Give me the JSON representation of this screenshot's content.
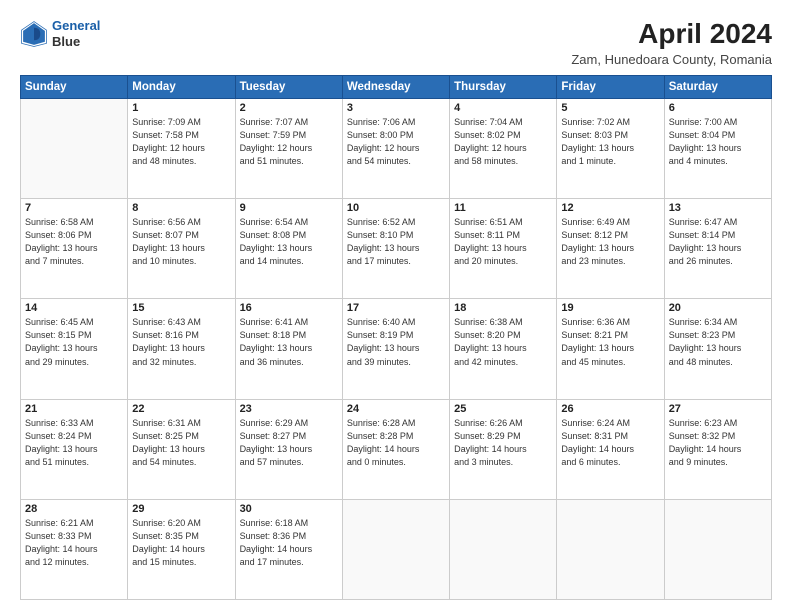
{
  "header": {
    "logo_line1": "General",
    "logo_line2": "Blue",
    "title": "April 2024",
    "subtitle": "Zam, Hunedoara County, Romania"
  },
  "days_of_week": [
    "Sunday",
    "Monday",
    "Tuesday",
    "Wednesday",
    "Thursday",
    "Friday",
    "Saturday"
  ],
  "weeks": [
    [
      {
        "day": "",
        "text": ""
      },
      {
        "day": "1",
        "text": "Sunrise: 7:09 AM\nSunset: 7:58 PM\nDaylight: 12 hours\nand 48 minutes."
      },
      {
        "day": "2",
        "text": "Sunrise: 7:07 AM\nSunset: 7:59 PM\nDaylight: 12 hours\nand 51 minutes."
      },
      {
        "day": "3",
        "text": "Sunrise: 7:06 AM\nSunset: 8:00 PM\nDaylight: 12 hours\nand 54 minutes."
      },
      {
        "day": "4",
        "text": "Sunrise: 7:04 AM\nSunset: 8:02 PM\nDaylight: 12 hours\nand 58 minutes."
      },
      {
        "day": "5",
        "text": "Sunrise: 7:02 AM\nSunset: 8:03 PM\nDaylight: 13 hours\nand 1 minute."
      },
      {
        "day": "6",
        "text": "Sunrise: 7:00 AM\nSunset: 8:04 PM\nDaylight: 13 hours\nand 4 minutes."
      }
    ],
    [
      {
        "day": "7",
        "text": "Sunrise: 6:58 AM\nSunset: 8:06 PM\nDaylight: 13 hours\nand 7 minutes."
      },
      {
        "day": "8",
        "text": "Sunrise: 6:56 AM\nSunset: 8:07 PM\nDaylight: 13 hours\nand 10 minutes."
      },
      {
        "day": "9",
        "text": "Sunrise: 6:54 AM\nSunset: 8:08 PM\nDaylight: 13 hours\nand 14 minutes."
      },
      {
        "day": "10",
        "text": "Sunrise: 6:52 AM\nSunset: 8:10 PM\nDaylight: 13 hours\nand 17 minutes."
      },
      {
        "day": "11",
        "text": "Sunrise: 6:51 AM\nSunset: 8:11 PM\nDaylight: 13 hours\nand 20 minutes."
      },
      {
        "day": "12",
        "text": "Sunrise: 6:49 AM\nSunset: 8:12 PM\nDaylight: 13 hours\nand 23 minutes."
      },
      {
        "day": "13",
        "text": "Sunrise: 6:47 AM\nSunset: 8:14 PM\nDaylight: 13 hours\nand 26 minutes."
      }
    ],
    [
      {
        "day": "14",
        "text": "Sunrise: 6:45 AM\nSunset: 8:15 PM\nDaylight: 13 hours\nand 29 minutes."
      },
      {
        "day": "15",
        "text": "Sunrise: 6:43 AM\nSunset: 8:16 PM\nDaylight: 13 hours\nand 32 minutes."
      },
      {
        "day": "16",
        "text": "Sunrise: 6:41 AM\nSunset: 8:18 PM\nDaylight: 13 hours\nand 36 minutes."
      },
      {
        "day": "17",
        "text": "Sunrise: 6:40 AM\nSunset: 8:19 PM\nDaylight: 13 hours\nand 39 minutes."
      },
      {
        "day": "18",
        "text": "Sunrise: 6:38 AM\nSunset: 8:20 PM\nDaylight: 13 hours\nand 42 minutes."
      },
      {
        "day": "19",
        "text": "Sunrise: 6:36 AM\nSunset: 8:21 PM\nDaylight: 13 hours\nand 45 minutes."
      },
      {
        "day": "20",
        "text": "Sunrise: 6:34 AM\nSunset: 8:23 PM\nDaylight: 13 hours\nand 48 minutes."
      }
    ],
    [
      {
        "day": "21",
        "text": "Sunrise: 6:33 AM\nSunset: 8:24 PM\nDaylight: 13 hours\nand 51 minutes."
      },
      {
        "day": "22",
        "text": "Sunrise: 6:31 AM\nSunset: 8:25 PM\nDaylight: 13 hours\nand 54 minutes."
      },
      {
        "day": "23",
        "text": "Sunrise: 6:29 AM\nSunset: 8:27 PM\nDaylight: 13 hours\nand 57 minutes."
      },
      {
        "day": "24",
        "text": "Sunrise: 6:28 AM\nSunset: 8:28 PM\nDaylight: 14 hours\nand 0 minutes."
      },
      {
        "day": "25",
        "text": "Sunrise: 6:26 AM\nSunset: 8:29 PM\nDaylight: 14 hours\nand 3 minutes."
      },
      {
        "day": "26",
        "text": "Sunrise: 6:24 AM\nSunset: 8:31 PM\nDaylight: 14 hours\nand 6 minutes."
      },
      {
        "day": "27",
        "text": "Sunrise: 6:23 AM\nSunset: 8:32 PM\nDaylight: 14 hours\nand 9 minutes."
      }
    ],
    [
      {
        "day": "28",
        "text": "Sunrise: 6:21 AM\nSunset: 8:33 PM\nDaylight: 14 hours\nand 12 minutes."
      },
      {
        "day": "29",
        "text": "Sunrise: 6:20 AM\nSunset: 8:35 PM\nDaylight: 14 hours\nand 15 minutes."
      },
      {
        "day": "30",
        "text": "Sunrise: 6:18 AM\nSunset: 8:36 PM\nDaylight: 14 hours\nand 17 minutes."
      },
      {
        "day": "",
        "text": ""
      },
      {
        "day": "",
        "text": ""
      },
      {
        "day": "",
        "text": ""
      },
      {
        "day": "",
        "text": ""
      }
    ]
  ]
}
